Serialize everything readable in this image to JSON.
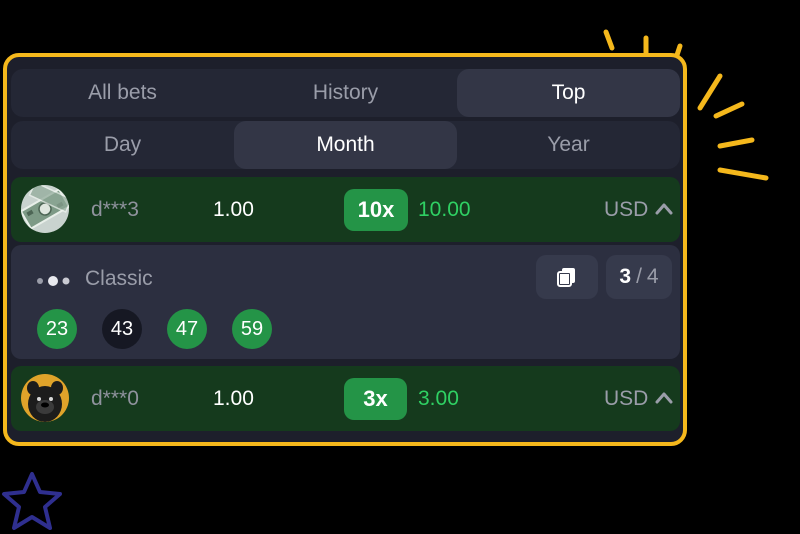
{
  "tabs": [
    {
      "label": "All bets",
      "active": false
    },
    {
      "label": "History",
      "active": false
    },
    {
      "label": "Top",
      "active": true
    }
  ],
  "periods": [
    {
      "label": "Day",
      "active": false
    },
    {
      "label": "Month",
      "active": true
    },
    {
      "label": "Year",
      "active": false
    }
  ],
  "rows": [
    {
      "user": "d***3",
      "bet": "1.00",
      "multiplier": "10x",
      "win": "10.00",
      "currency": "USD",
      "expanded": true
    },
    {
      "user": "d***0",
      "bet": "1.00",
      "multiplier": "3x",
      "win": "3.00",
      "currency": "USD",
      "expanded": false
    }
  ],
  "detail": {
    "game": "Classic",
    "page_current": "3",
    "page_separator": "/",
    "page_total": "4",
    "balls": [
      {
        "value": "23",
        "state": "hit"
      },
      {
        "value": "43",
        "state": "miss"
      },
      {
        "value": "47",
        "state": "hit"
      },
      {
        "value": "59",
        "state": "hit"
      }
    ]
  },
  "colors": {
    "frame": "#f5b81c",
    "accent_green": "#249447",
    "win_text": "#2fd063",
    "row_bg": "#153a1d"
  },
  "icons": [
    "avatar-money",
    "avatar-dog",
    "chevron-up-icon",
    "copy-icon",
    "dots-icon",
    "star-icon",
    "sparkle-rays"
  ]
}
